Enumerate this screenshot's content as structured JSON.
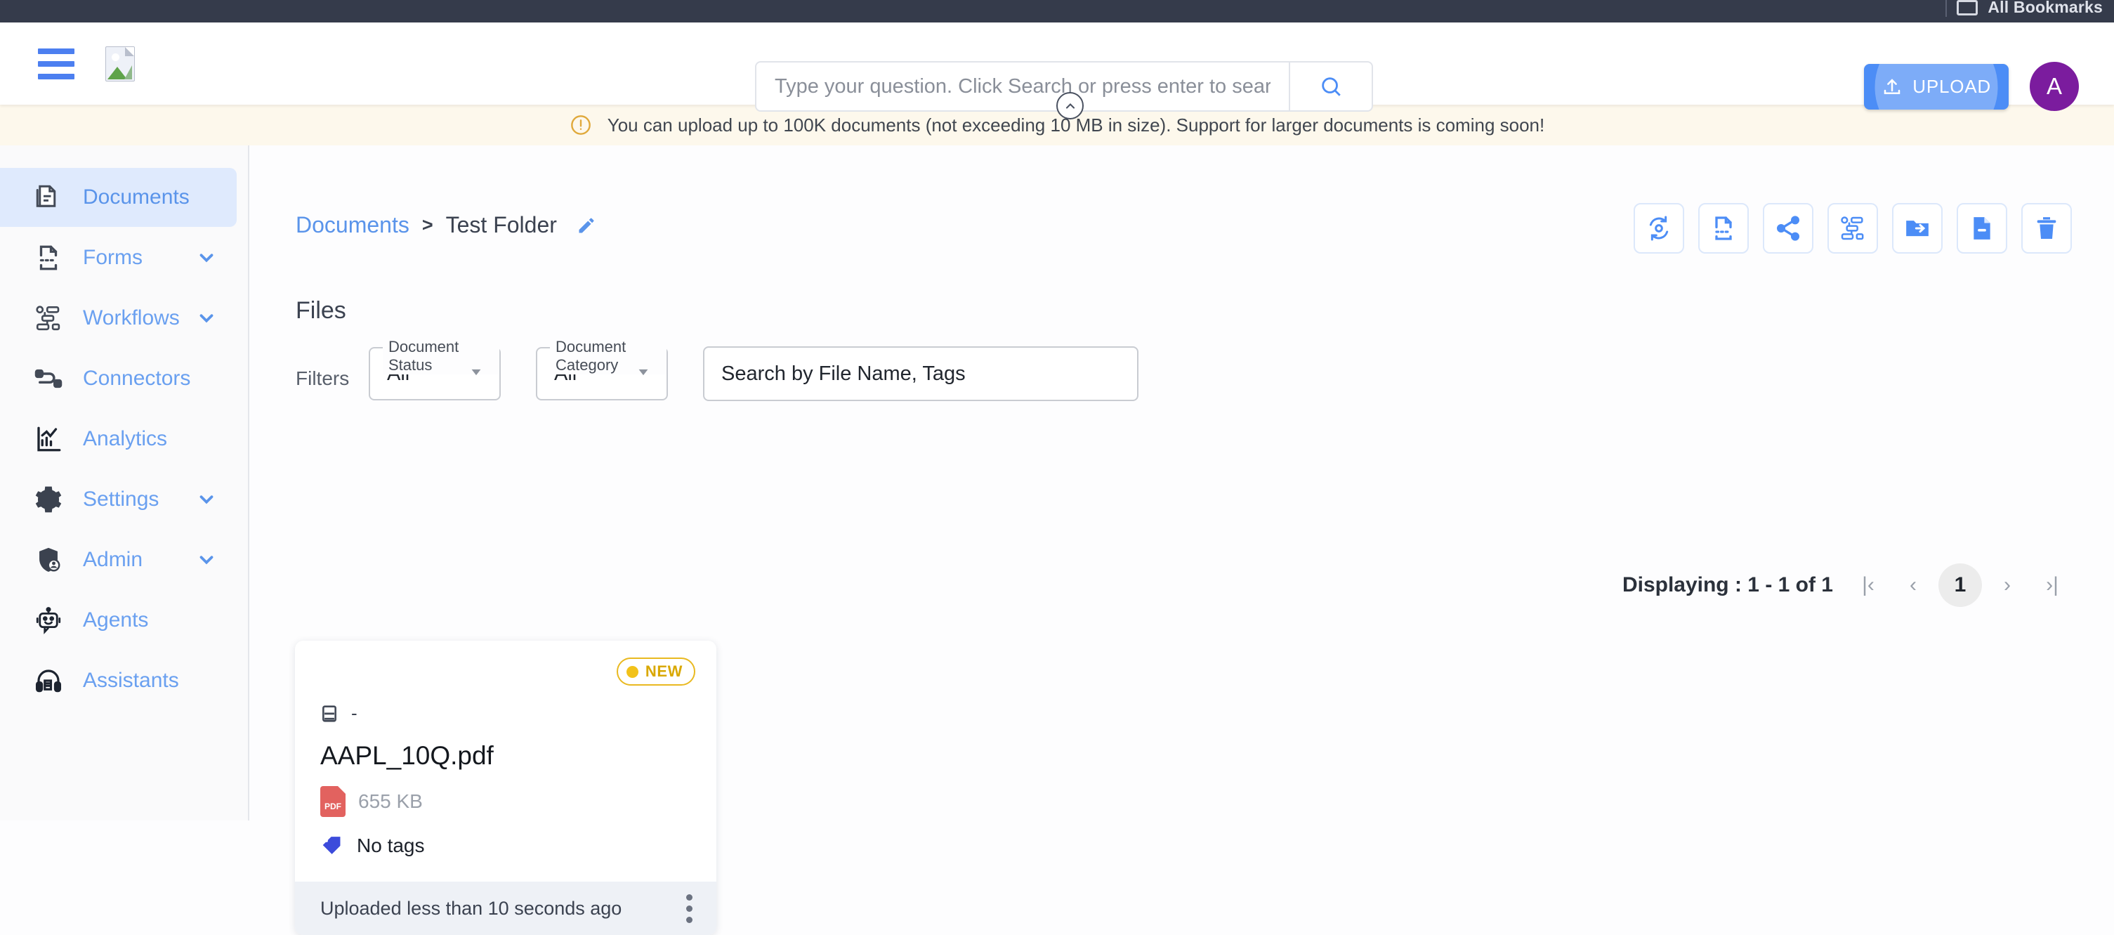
{
  "browser": {
    "bookmarks_label": "All Bookmarks"
  },
  "header": {
    "search": {
      "placeholder": "Type your question. Click Search or press enter to search",
      "value": "",
      "search_icon": "search-icon"
    },
    "upload_label": "UPLOAD",
    "upload_icon": "upload-icon",
    "avatar_initial": "A",
    "menu_icon": "hamburger-menu-icon",
    "logo_icon": "broken-image-logo-icon"
  },
  "banner": {
    "icon": "alert-circle-icon",
    "text": "You can upload up to 100K documents (not exceeding 10 MB in size). Support for larger documents is coming soon!",
    "collapse_icon": "chevron-up-icon"
  },
  "sidebar": {
    "items": [
      {
        "label": "Documents",
        "icon": "documents-icon",
        "active": true,
        "expandable": false
      },
      {
        "label": "Forms",
        "icon": "forms-icon",
        "active": false,
        "expandable": true
      },
      {
        "label": "Workflows",
        "icon": "workflows-icon",
        "active": false,
        "expandable": true
      },
      {
        "label": "Connectors",
        "icon": "connectors-icon",
        "active": false,
        "expandable": false
      },
      {
        "label": "Analytics",
        "icon": "analytics-icon",
        "active": false,
        "expandable": false
      },
      {
        "label": "Settings",
        "icon": "settings-gear-icon",
        "active": false,
        "expandable": true
      },
      {
        "label": "Admin",
        "icon": "admin-shield-icon",
        "active": false,
        "expandable": true
      },
      {
        "label": "Agents",
        "icon": "agents-robot-icon",
        "active": false,
        "expandable": false
      },
      {
        "label": "Assistants",
        "icon": "assistants-headset-icon",
        "active": false,
        "expandable": false
      }
    ]
  },
  "main": {
    "breadcrumb": {
      "root": "Documents",
      "separator": ">",
      "current": "Test Folder",
      "edit_icon": "edit-pencil-icon"
    },
    "toolbar": [
      {
        "name": "reprocess-document-button",
        "icon": "reprocess-gear-sync-icon"
      },
      {
        "name": "extract-form-button",
        "icon": "form-extract-icon"
      },
      {
        "name": "share-button",
        "icon": "share-icon"
      },
      {
        "name": "run-workflow-button",
        "icon": "workflow-icon"
      },
      {
        "name": "move-to-folder-button",
        "icon": "move-folder-icon"
      },
      {
        "name": "remove-document-button",
        "icon": "document-minus-icon"
      },
      {
        "name": "delete-button",
        "icon": "trash-icon"
      }
    ],
    "section_title": "Files",
    "filters": {
      "label": "Filters",
      "document_status": {
        "legend": "Document Status",
        "value": "All",
        "options": [
          "All"
        ]
      },
      "document_category": {
        "legend": "Document Category",
        "value": "All",
        "options": [
          "All"
        ]
      },
      "file_search": {
        "placeholder": "Search by File Name, Tags",
        "value": ""
      }
    },
    "pagination": {
      "displaying": "Displaying : 1 - 1 of 1",
      "first_label": "|‹",
      "prev_label": "‹",
      "current_page": "1",
      "next_label": "›",
      "last_label": "›|"
    },
    "files": [
      {
        "badge": "NEW",
        "meta_value": "-",
        "meta_icon": "database-icon",
        "filename": "AAPL_10Q.pdf",
        "filetype_icon": "pdf-file-icon",
        "size": "655 KB",
        "tags_icon": "tag-icon",
        "tags": "No tags",
        "uploaded": "Uploaded less than 10 seconds ago",
        "menu_icon": "kebab-menu-icon"
      }
    ]
  },
  "colors": {
    "accent_blue": "#4C8DF6",
    "nav_link": "#6AA0F0",
    "active_nav_bg": "#DFEAFD",
    "banner_bg": "#FDF8EC",
    "badge_yellow": "#E9B920",
    "avatar_purple": "#7B1C9E",
    "chrome_dark": "#353B4B",
    "pdf_red": "#E2625F"
  }
}
